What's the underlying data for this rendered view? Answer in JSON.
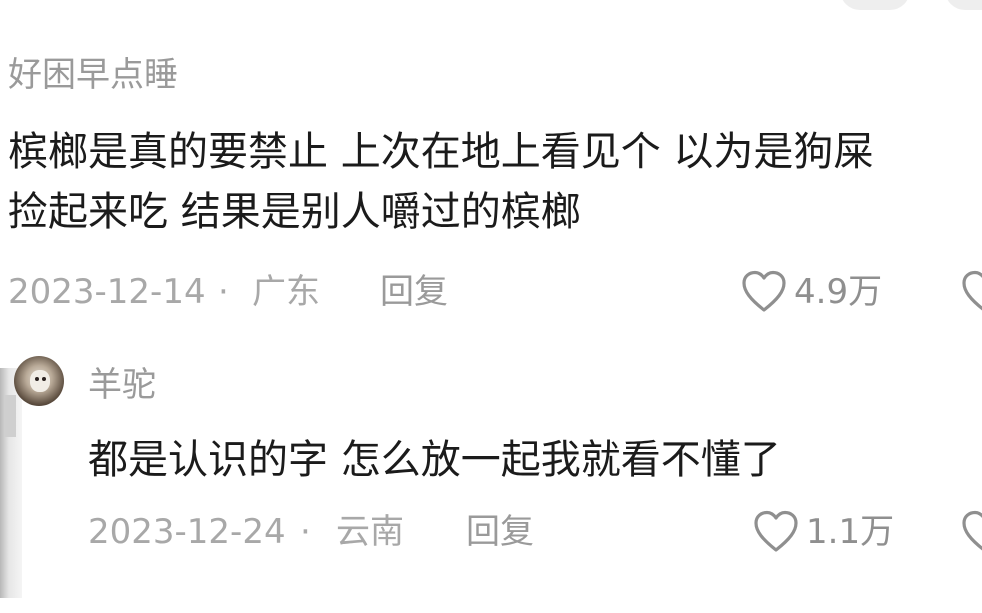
{
  "comments": [
    {
      "username": "好困早点睡",
      "text_lines": [
        "槟榔是真的要禁止 上次在地上看见个 以为是狗屎",
        "捡起来吃 结果是别人嚼过的槟榔"
      ],
      "date": "2023-12-14",
      "separator": "·",
      "location": "广东",
      "reply_label": "回复",
      "likes": "4.9万"
    },
    {
      "username": "羊驼",
      "text_lines": [
        "都是认识的字 怎么放一起我就看不懂了"
      ],
      "date": "2023-12-24",
      "separator": "·",
      "location": "云南",
      "reply_label": "回复",
      "likes": "1.1万"
    }
  ],
  "icons": {
    "like": "heart-outline-icon",
    "edge": "heart-outline-icon-partial"
  },
  "colors": {
    "text": "#1b1b1b",
    "username": "#9a9a9a",
    "meta": "#a8a8a8",
    "icon": "#8f8f8f"
  }
}
